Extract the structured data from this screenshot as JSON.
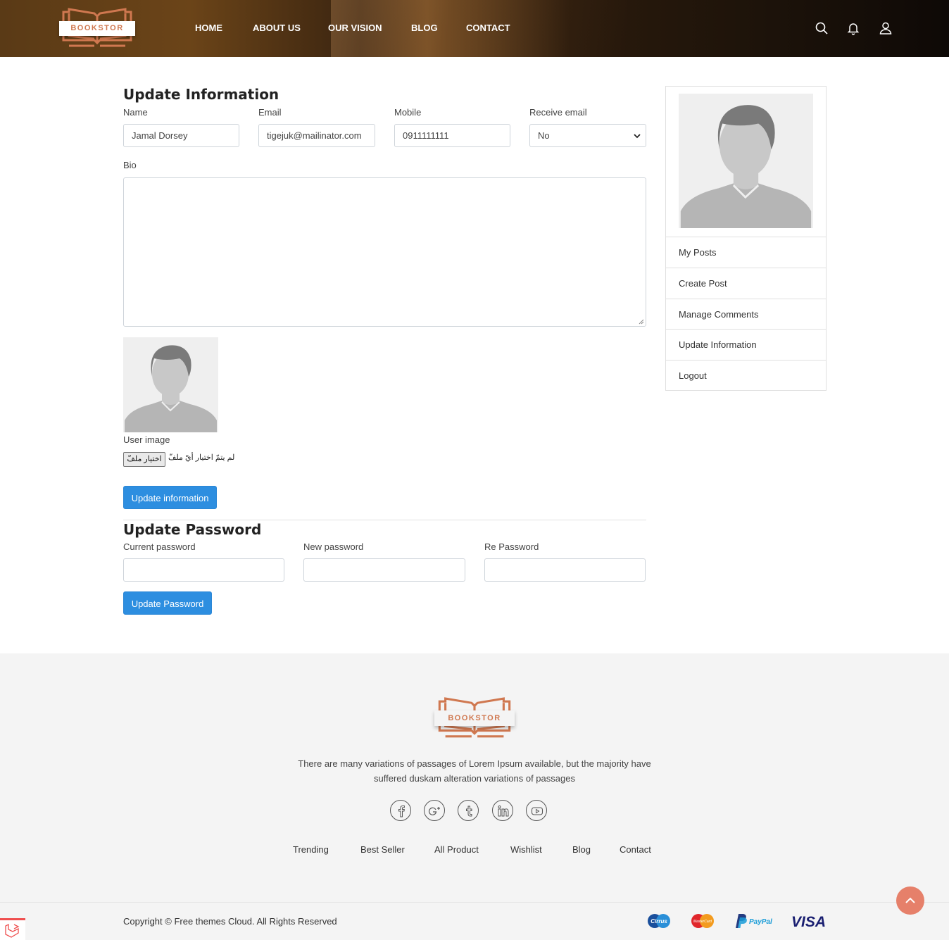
{
  "header": {
    "logo_text": "BOOKSTOR",
    "nav": [
      "HOME",
      "ABOUT US",
      "OUR VISION",
      "BLOG",
      "CONTACT"
    ],
    "icons": [
      "search-icon",
      "bell-icon",
      "user-icon"
    ]
  },
  "update_info": {
    "title": "Update Information",
    "name_label": "Name",
    "name_value": "Jamal Dorsey",
    "email_label": "Email",
    "email_value": "tigejuk@mailinator.com",
    "mobile_label": "Mobile",
    "mobile_value": "0911111111",
    "receive_email_label": "Receive email",
    "receive_email_value": "No",
    "bio_label": "Bio",
    "user_image_label": "User image",
    "file_button": "اختيار ملفّ",
    "file_status": "لم يتمّ اختيار أيّ ملفّ",
    "submit": "Update information"
  },
  "update_password": {
    "title": "Update Password",
    "current_label": "Current password",
    "new_label": "New password",
    "re_label": "Re Password",
    "submit": "Update Password"
  },
  "sidebar": {
    "items": [
      "My Posts",
      "Create Post",
      "Manage Comments",
      "Update Information",
      "Logout"
    ]
  },
  "footer": {
    "logo_text": "BOOKSTOR",
    "description_line1": "There are many variations of passages of Lorem Ipsum available, but the majority have",
    "description_line2": "suffered duskam alteration variations of passages",
    "social": [
      "facebook-icon",
      "google-plus-icon",
      "tumblr-icon",
      "linkedin-icon",
      "youtube-icon"
    ],
    "links": [
      "Trending",
      "Best Seller",
      "All Product",
      "Wishlist",
      "Blog",
      "Contact"
    ],
    "copyright": "Copyright © Free themes Cloud. All Rights Reserved",
    "payments": [
      "Cirrus",
      "MasterCard",
      "PayPal",
      "VISA"
    ]
  },
  "colors": {
    "accent": "#2d8ee0",
    "brand": "#d07850",
    "to_top": "#e6806a"
  }
}
